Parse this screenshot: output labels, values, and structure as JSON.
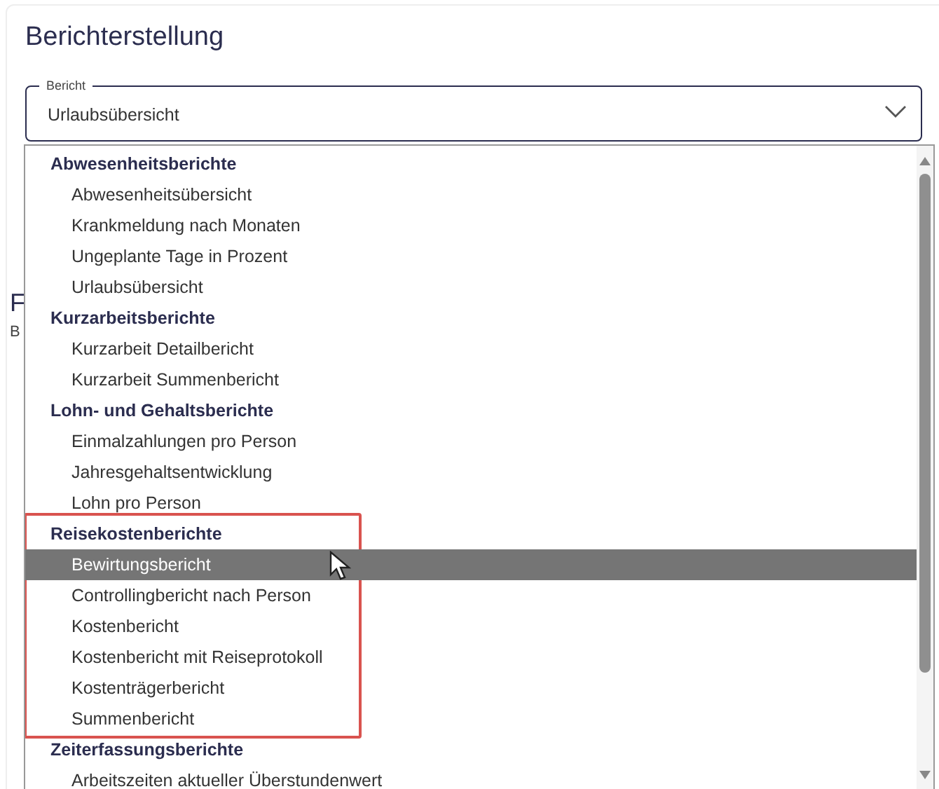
{
  "title": "Berichterstellung",
  "field": {
    "label": "Bericht",
    "value": "Urlaubsübersicht",
    "expanded": true
  },
  "background": {
    "heading": "F",
    "text": "B"
  },
  "groups": [
    {
      "label": "Abwesenheitsberichte",
      "highlighted": false,
      "items": [
        {
          "label": "Abwesenheitsübersicht",
          "hovered": false
        },
        {
          "label": "Krankmeldung nach Monaten",
          "hovered": false
        },
        {
          "label": "Ungeplante Tage in Prozent",
          "hovered": false
        },
        {
          "label": "Urlaubsübersicht",
          "hovered": false
        }
      ]
    },
    {
      "label": "Kurzarbeitsberichte",
      "highlighted": false,
      "items": [
        {
          "label": "Kurzarbeit Detailbericht",
          "hovered": false
        },
        {
          "label": "Kurzarbeit Summenbericht",
          "hovered": false
        }
      ]
    },
    {
      "label": "Lohn- und Gehaltsberichte",
      "highlighted": false,
      "items": [
        {
          "label": "Einmalzahlungen pro Person",
          "hovered": false
        },
        {
          "label": "Jahresgehaltsentwicklung",
          "hovered": false
        },
        {
          "label": "Lohn pro Person",
          "hovered": false
        }
      ]
    },
    {
      "label": "Reisekostenberichte",
      "highlighted": true,
      "items": [
        {
          "label": "Bewirtungsbericht",
          "hovered": true
        },
        {
          "label": "Controllingbericht nach Person",
          "hovered": false
        },
        {
          "label": "Kostenbericht",
          "hovered": false
        },
        {
          "label": "Kostenbericht mit Reiseprotokoll",
          "hovered": false
        },
        {
          "label": "Kostenträgerbericht",
          "hovered": false
        },
        {
          "label": "Summenbericht",
          "hovered": false
        }
      ]
    },
    {
      "label": "Zeiterfassungsberichte",
      "highlighted": false,
      "items": [
        {
          "label": "Arbeitszeiten aktueller Überstundenwert",
          "hovered": false
        }
      ]
    }
  ]
}
